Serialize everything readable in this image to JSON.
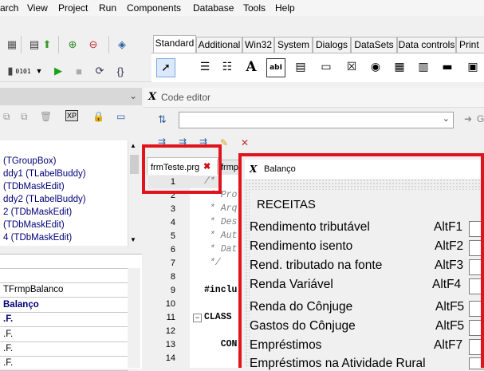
{
  "menu": [
    "arch",
    "View",
    "Project",
    "Run",
    "Components",
    "Database",
    "Tools",
    "Help"
  ],
  "palette": {
    "tabs": [
      "Standard",
      "Additional",
      "Win32",
      "System",
      "Dialogs",
      "DataSets",
      "Data controls",
      "Print"
    ],
    "icon_letter": "A",
    "icon_ab": "abI"
  },
  "tree": {
    "rows": [
      "(TGroupBox)",
      "ddy1  (TLabelBuddy)",
      "(TDbMaskEdit)",
      "ddy2  (TLabelBuddy)",
      "2  (TDbMaskEdit)",
      "(TDbMaskEdit)",
      "4  (TDbMaskEdit)"
    ]
  },
  "props": {
    "rows": [
      "",
      "",
      "TFrmpBalanco",
      "Balanço",
      ".F.",
      ".F.",
      ".F.",
      ".F."
    ]
  },
  "editor": {
    "title": "Code editor",
    "tab_active": "frmTeste.prg",
    "tab_other": "frmpB",
    "line_numbers": [
      "1",
      "2",
      "3",
      "4",
      "5",
      "6",
      "7",
      "8",
      "9",
      "10",
      "11",
      "12",
      "13",
      "14"
    ],
    "code": {
      "l1": "/*",
      "l2": " * Pro",
      "l3": " * Arq",
      "l4": " * Des",
      "l5": " * Aut",
      "l6": " * Dat",
      "l7": " */",
      "l9": "#inclu",
      "l11": "CLASS",
      "l13": "   CON"
    },
    "side_letter": "G"
  },
  "balanco": {
    "title": "Balanço",
    "section": "RECEITAS",
    "rows": [
      {
        "label": "Rendimento tributável",
        "key": "AltF1"
      },
      {
        "label": "Rendimento isento",
        "key": "AltF2"
      },
      {
        "label": "Rend. tributado na fonte",
        "key": "AltF3"
      },
      {
        "label": "Renda Variável",
        "key": "AltF4"
      },
      {
        "label": "Renda do Cônjuge",
        "key": "AltF5"
      },
      {
        "label": "Gastos do Cônjuge",
        "key": "AltF5"
      },
      {
        "label": "Empréstimos",
        "key": "AltF7"
      },
      {
        "label": "Empréstimos na Atividade Rural",
        "key": ""
      }
    ]
  },
  "colors": {
    "highlight": "#e0141c",
    "tree_text": "#00007a"
  }
}
